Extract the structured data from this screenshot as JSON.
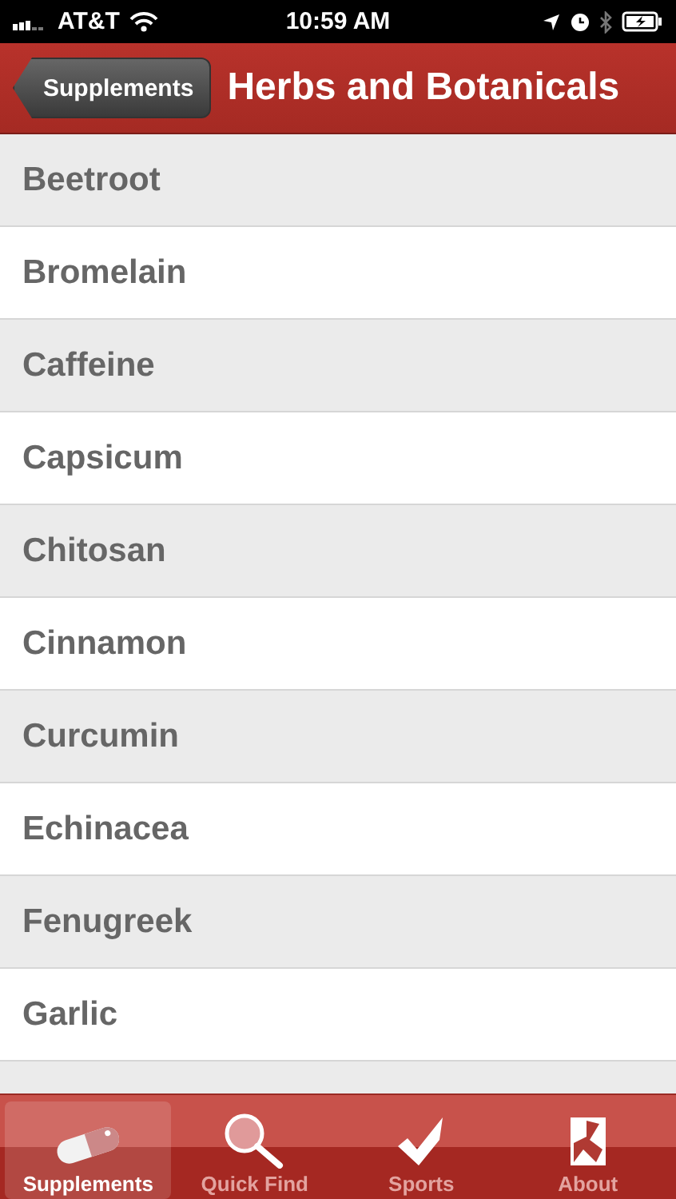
{
  "status_bar": {
    "carrier": "AT&T",
    "time": "10:59 AM"
  },
  "nav": {
    "back": "Supplements",
    "title": "Herbs and Botanicals"
  },
  "items": [
    {
      "label": "Beetroot"
    },
    {
      "label": "Bromelain"
    },
    {
      "label": "Caffeine"
    },
    {
      "label": "Capsicum"
    },
    {
      "label": "Chitosan"
    },
    {
      "label": "Cinnamon"
    },
    {
      "label": "Curcumin"
    },
    {
      "label": "Echinacea"
    },
    {
      "label": "Fenugreek"
    },
    {
      "label": "Garlic"
    }
  ],
  "tabs": [
    {
      "label": "Supplements",
      "kind": "pill",
      "selected": true
    },
    {
      "label": "Quick Find",
      "kind": "search",
      "selected": false
    },
    {
      "label": "Sports",
      "kind": "check",
      "selected": false
    },
    {
      "label": "About",
      "kind": "about",
      "selected": false
    }
  ]
}
